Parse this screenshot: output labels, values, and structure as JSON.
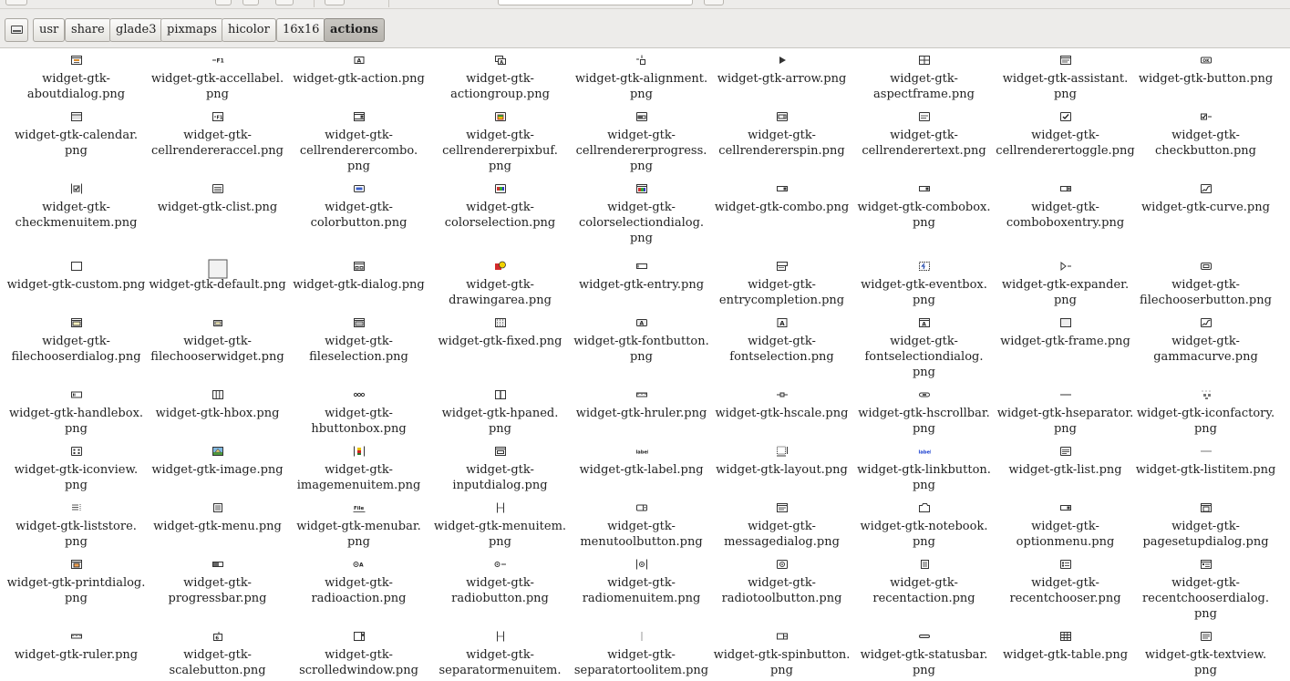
{
  "path_bar": {
    "crumbs": [
      "usr",
      "share",
      "glade3",
      "pixmaps",
      "hicolor",
      "16x16",
      "actions"
    ],
    "active": "actions"
  },
  "files": [
    [
      "widget-gtk-",
      "aboutdialog.png"
    ],
    [
      "widget-gtk-accellabel.",
      "png"
    ],
    [
      "widget-gtk-action.png"
    ],
    [
      "widget-gtk-",
      "actiongroup.png"
    ],
    [
      "widget-gtk-alignment.",
      "png"
    ],
    [
      "widget-gtk-arrow.png"
    ],
    [
      "widget-gtk-",
      "aspectframe.png"
    ],
    [
      "widget-gtk-assistant.",
      "png"
    ],
    [
      "widget-gtk-button.png"
    ],
    [
      "widget-gtk-calendar.",
      "png"
    ],
    [
      "widget-gtk-",
      "cellrendereraccel.png"
    ],
    [
      "widget-gtk-",
      "cellrenderercombo.",
      "png"
    ],
    [
      "widget-gtk-",
      "cellrendererpixbuf.",
      "png"
    ],
    [
      "widget-gtk-",
      "cellrendererprogress.",
      "png"
    ],
    [
      "widget-gtk-",
      "cellrendererspin.png"
    ],
    [
      "widget-gtk-",
      "cellrenderertext.png"
    ],
    [
      "widget-gtk-",
      "cellrenderertoggle.png"
    ],
    [
      "widget-gtk-",
      "checkbutton.png"
    ],
    [
      "widget-gtk-",
      "checkmenuitem.png"
    ],
    [
      "widget-gtk-clist.png"
    ],
    [
      "widget-gtk-",
      "colorbutton.png"
    ],
    [
      "widget-gtk-",
      "colorselection.png"
    ],
    [
      "widget-gtk-",
      "colorselectiondialog.",
      "png"
    ],
    [
      "widget-gtk-combo.png"
    ],
    [
      "widget-gtk-combobox.",
      "png"
    ],
    [
      "widget-gtk-",
      "comboboxentry.png"
    ],
    [
      "widget-gtk-curve.png"
    ],
    [
      "widget-gtk-custom.png"
    ],
    [
      "widget-gtk-default.png"
    ],
    [
      "widget-gtk-dialog.png"
    ],
    [
      "widget-gtk-",
      "drawingarea.png"
    ],
    [
      "widget-gtk-entry.png"
    ],
    [
      "widget-gtk-",
      "entrycompletion.png"
    ],
    [
      "widget-gtk-eventbox.",
      "png"
    ],
    [
      "widget-gtk-expander.",
      "png"
    ],
    [
      "widget-gtk-",
      "filechooserbutton.png"
    ],
    [
      "widget-gtk-",
      "filechooserdialog.png"
    ],
    [
      "widget-gtk-",
      "filechooserwidget.png"
    ],
    [
      "widget-gtk-",
      "fileselection.png"
    ],
    [
      "widget-gtk-fixed.png"
    ],
    [
      "widget-gtk-fontbutton.",
      "png"
    ],
    [
      "widget-gtk-",
      "fontselection.png"
    ],
    [
      "widget-gtk-",
      "fontselectiondialog.",
      "png"
    ],
    [
      "widget-gtk-frame.png"
    ],
    [
      "widget-gtk-",
      "gammacurve.png"
    ],
    [
      "widget-gtk-handlebox.",
      "png"
    ],
    [
      "widget-gtk-hbox.png"
    ],
    [
      "widget-gtk-",
      "hbuttonbox.png"
    ],
    [
      "widget-gtk-hpaned.",
      "png"
    ],
    [
      "widget-gtk-hruler.png"
    ],
    [
      "widget-gtk-hscale.png"
    ],
    [
      "widget-gtk-hscrollbar.",
      "png"
    ],
    [
      "widget-gtk-hseparator.",
      "png"
    ],
    [
      "widget-gtk-iconfactory.",
      "png"
    ],
    [
      "widget-gtk-iconview.",
      "png"
    ],
    [
      "widget-gtk-image.png"
    ],
    [
      "widget-gtk-",
      "imagemenuitem.png"
    ],
    [
      "widget-gtk-",
      "inputdialog.png"
    ],
    [
      "widget-gtk-label.png"
    ],
    [
      "widget-gtk-layout.png"
    ],
    [
      "widget-gtk-linkbutton.",
      "png"
    ],
    [
      "widget-gtk-list.png"
    ],
    [
      "widget-gtk-listitem.png"
    ],
    [
      "widget-gtk-liststore.",
      "png"
    ],
    [
      "widget-gtk-menu.png"
    ],
    [
      "widget-gtk-menubar.",
      "png"
    ],
    [
      "widget-gtk-menuitem.",
      "png"
    ],
    [
      "widget-gtk-",
      "menutoolbutton.png"
    ],
    [
      "widget-gtk-",
      "messagedialog.png"
    ],
    [
      "widget-gtk-notebook.",
      "png"
    ],
    [
      "widget-gtk-",
      "optionmenu.png"
    ],
    [
      "widget-gtk-",
      "pagesetupdialog.png"
    ],
    [
      "widget-gtk-printdialog.",
      "png"
    ],
    [
      "widget-gtk-",
      "progressbar.png"
    ],
    [
      "widget-gtk-",
      "radioaction.png"
    ],
    [
      "widget-gtk-",
      "radiobutton.png"
    ],
    [
      "widget-gtk-",
      "radiomenuitem.png"
    ],
    [
      "widget-gtk-",
      "radiotoolbutton.png"
    ],
    [
      "widget-gtk-",
      "recentaction.png"
    ],
    [
      "widget-gtk-",
      "recentchooser.png"
    ],
    [
      "widget-gtk-",
      "recentchooserdialog.",
      "png"
    ],
    [
      "widget-gtk-ruler.png"
    ],
    [
      "widget-gtk-",
      "scalebutton.png"
    ],
    [
      "widget-gtk-",
      "scrolledwindow.png"
    ],
    [
      "widget-gtk-",
      "separatormenuitem."
    ],
    [
      "widget-gtk-",
      "separatortoolitem.png"
    ],
    [
      "widget-gtk-spinbutton.",
      "png"
    ],
    [
      "widget-gtk-statusbar.",
      "png"
    ],
    [
      "widget-gtk-table.png"
    ],
    [
      "widget-gtk-textview.",
      "png"
    ]
  ],
  "icon_text": {
    "accellabel": "F1",
    "cellrendereraccel": "F1",
    "action": "A",
    "fontbutton": "A",
    "fontselection": "A",
    "fontselectiondialog": "A",
    "button": "OK",
    "label": "label",
    "linkbutton": "label",
    "menubar": "File",
    "scalebutton": "6"
  }
}
